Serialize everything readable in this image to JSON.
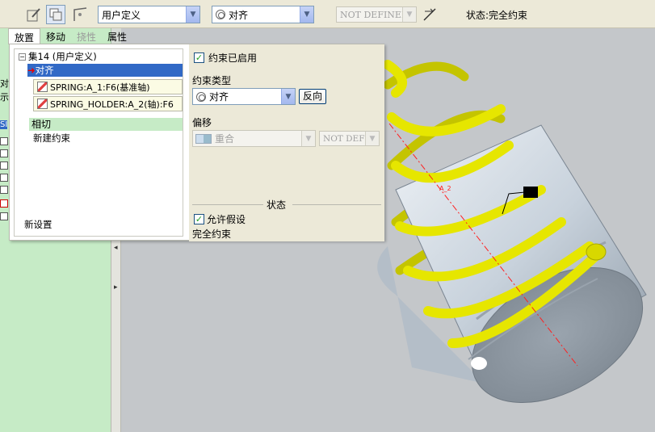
{
  "toolbar": {
    "set_type": "用户定义",
    "constraint_type": "对齐",
    "offset_state": "NOT DEFINED",
    "status": "状态:完全约束"
  },
  "tabs": {
    "placement": "放置",
    "move": "移动",
    "flexibility": "挠性",
    "properties": "属性"
  },
  "tree": {
    "set": "集14 (用户定义)",
    "align": "对齐",
    "ref1": "SPRING:A_1:F6(基准轴)",
    "ref2": "SPRING_HOLDER:A_2(轴):F6",
    "tangent": "相切",
    "new_constraint": "新建约束",
    "new_set": "新设置"
  },
  "details": {
    "enabled": "约束已启用",
    "type_label": "约束类型",
    "type_value": "对齐",
    "flip": "反向",
    "offset_label": "偏移",
    "offset_value": "重合",
    "offset_state": "NOT DEFI",
    "status_header": "状态",
    "allow_assumptions": "允许假设",
    "status_value": "完全约束"
  },
  "viewport": {
    "axis_label": "A_2"
  },
  "leftstrip": {
    "frag1": "对",
    "frag2": "示",
    "frag3": "SI"
  },
  "colors": {
    "spring": "#e6e600",
    "holder": "#c8d2dc",
    "selection": "#3169c6",
    "tree_green": "#c6ebc6"
  }
}
